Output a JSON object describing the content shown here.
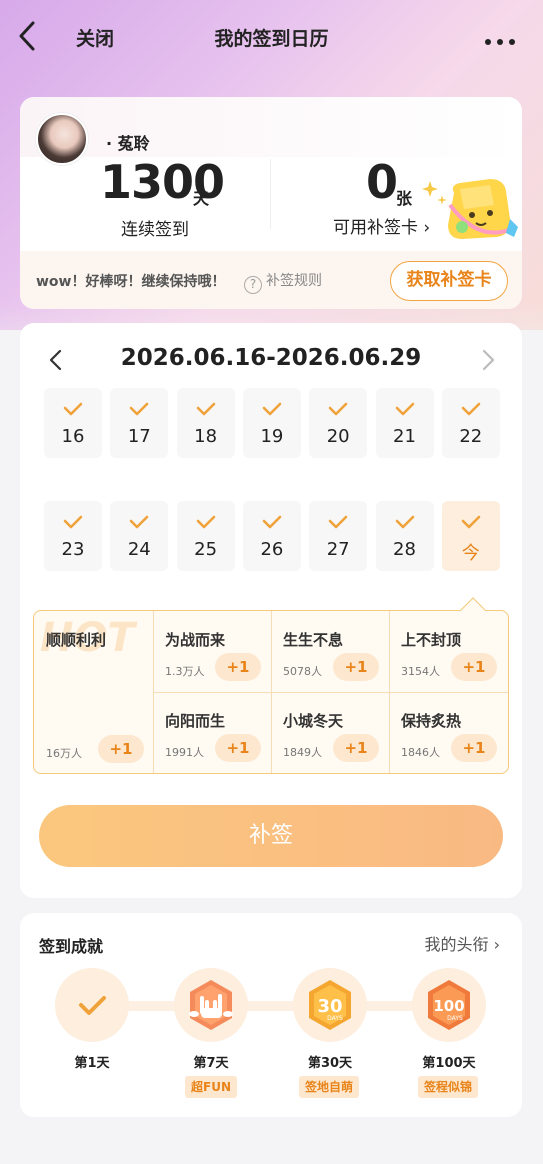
{
  "header": {
    "close_label": "关闭",
    "title": "我的签到日历"
  },
  "profile": {
    "username": "· 菟聆",
    "streak_days": "1300",
    "streak_unit": "天",
    "streak_label": "连续签到",
    "cards_count": "0",
    "cards_unit": "张",
    "cards_label": "可用补签卡 ›"
  },
  "encourage": {
    "text": "wow！好棒呀！继续保持哦！",
    "rule_label": "补签规则",
    "get_card_label": "获取补签卡"
  },
  "calendar": {
    "range": "2026.06.16-2026.06.29",
    "days": [
      {
        "label": "16",
        "checked": true
      },
      {
        "label": "17",
        "checked": true
      },
      {
        "label": "18",
        "checked": true
      },
      {
        "label": "19",
        "checked": true
      },
      {
        "label": "20",
        "checked": true
      },
      {
        "label": "21",
        "checked": true
      },
      {
        "label": "22",
        "checked": true
      },
      {
        "label": "23",
        "checked": true
      },
      {
        "label": "24",
        "checked": true
      },
      {
        "label": "25",
        "checked": true
      },
      {
        "label": "26",
        "checked": true
      },
      {
        "label": "27",
        "checked": true
      },
      {
        "label": "28",
        "checked": true
      },
      {
        "label": "今",
        "checked": true,
        "today": true
      }
    ]
  },
  "hot": {
    "watermark": "HOT",
    "featured": {
      "name": "顺顺利利",
      "count": "16万人",
      "plus": "+1"
    },
    "topics": [
      {
        "name": "为战而来",
        "count": "1.3万人",
        "plus": "+1"
      },
      {
        "name": "生生不息",
        "count": "5078人",
        "plus": "+1"
      },
      {
        "name": "上不封顶",
        "count": "3154人",
        "plus": "+1"
      },
      {
        "name": "向阳而生",
        "count": "1991人",
        "plus": "+1"
      },
      {
        "name": "小城冬天",
        "count": "1849人",
        "plus": "+1"
      },
      {
        "name": "保持炙热",
        "count": "1846人",
        "plus": "+1"
      }
    ]
  },
  "makeup_label": "补签",
  "achievements": {
    "title": "签到成就",
    "my_titles_label": "我的头衔 ›",
    "items": [
      {
        "day": "第1天",
        "tag": "",
        "icon": "check-icon"
      },
      {
        "day": "第7天",
        "tag": "超FUN",
        "icon": "rock-hand-badge-icon"
      },
      {
        "day": "第30天",
        "tag": "签地自萌",
        "icon": "30-days-badge-icon",
        "badge_text": "30",
        "badge_sub": "DAYS"
      },
      {
        "day": "第100天",
        "tag": "签程似锦",
        "icon": "100-days-badge-icon",
        "badge_text": "100",
        "badge_sub": "DAYS"
      }
    ]
  },
  "colors": {
    "accent": "#e8841a",
    "check": "#f0a23a",
    "tag_bg": "#fde8cf"
  }
}
